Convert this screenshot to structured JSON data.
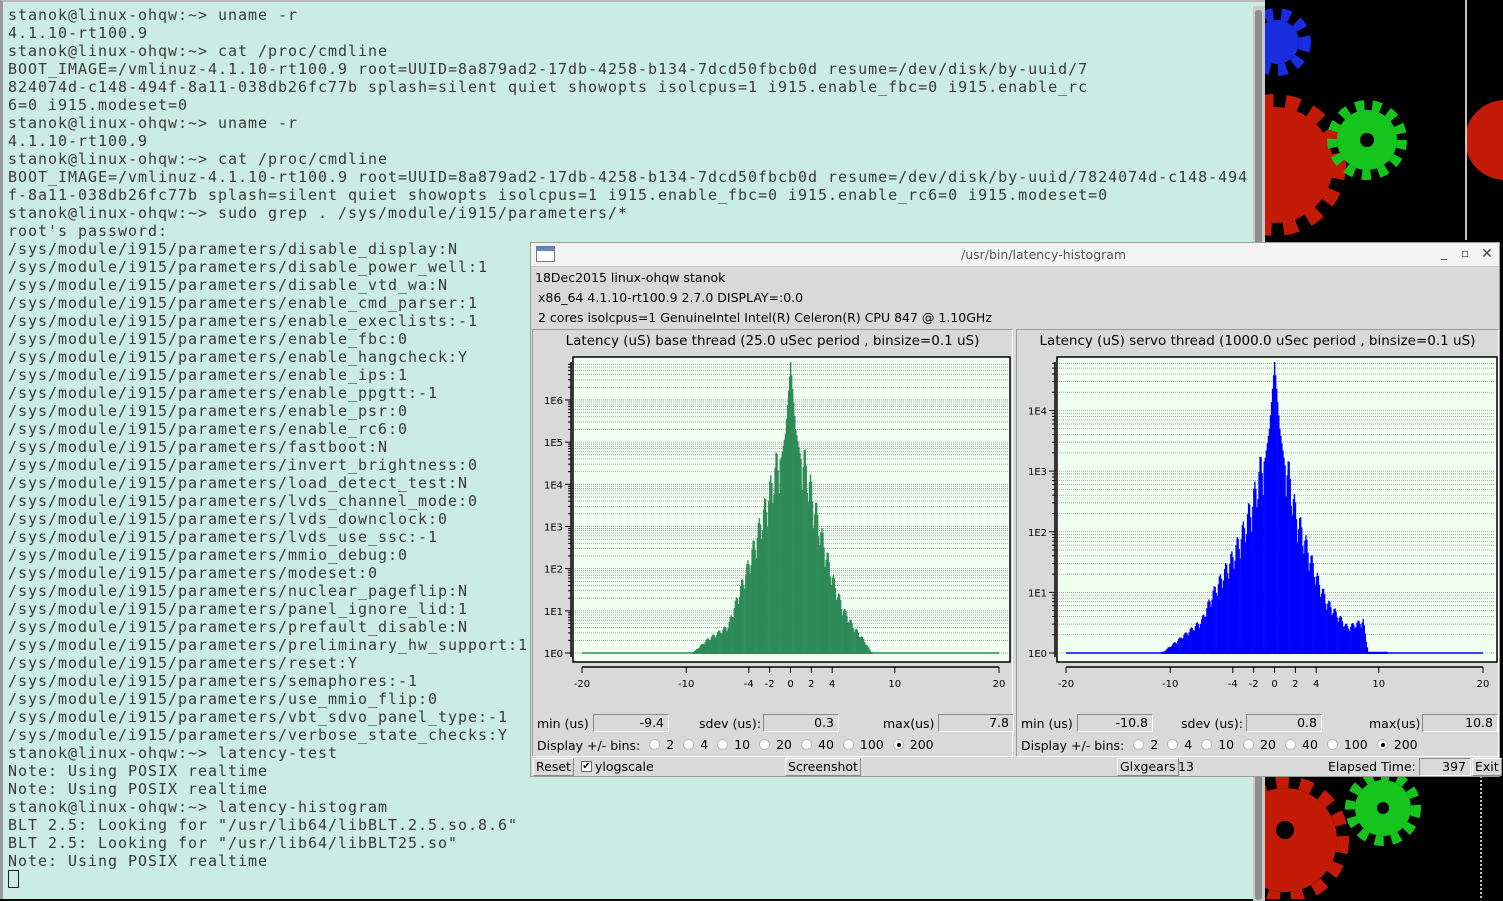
{
  "terminal": {
    "lines": [
      "stanok@linux-ohqw:~> uname -r",
      "4.1.10-rt100.9",
      "stanok@linux-ohqw:~> cat /proc/cmdline",
      "BOOT_IMAGE=/vmlinuz-4.1.10-rt100.9 root=UUID=8a879ad2-17db-4258-b134-7dcd50fbcb0d resume=/dev/disk/by-uuid/7",
      "824074d-c148-494f-8a11-038db26fc77b splash=silent quiet showopts isolcpus=1 i915.enable_fbc=0 i915.enable_rc",
      "6=0 i915.modeset=0",
      "stanok@linux-ohqw:~> uname -r",
      "4.1.10-rt100.9",
      "stanok@linux-ohqw:~> cat /proc/cmdline",
      "BOOT_IMAGE=/vmlinuz-4.1.10-rt100.9 root=UUID=8a879ad2-17db-4258-b134-7dcd50fbcb0d resume=/dev/disk/by-uuid/7824074d-c148-494",
      "f-8a11-038db26fc77b splash=silent quiet showopts isolcpus=1 i915.enable_fbc=0 i915.enable_rc6=0 i915.modeset=0",
      "stanok@linux-ohqw:~> sudo grep . /sys/module/i915/parameters/*",
      "root's password:",
      "/sys/module/i915/parameters/disable_display:N",
      "/sys/module/i915/parameters/disable_power_well:1",
      "/sys/module/i915/parameters/disable_vtd_wa:N",
      "/sys/module/i915/parameters/enable_cmd_parser:1",
      "/sys/module/i915/parameters/enable_execlists:-1",
      "/sys/module/i915/parameters/enable_fbc:0",
      "/sys/module/i915/parameters/enable_hangcheck:Y",
      "/sys/module/i915/parameters/enable_ips:1",
      "/sys/module/i915/parameters/enable_ppgtt:-1",
      "/sys/module/i915/parameters/enable_psr:0",
      "/sys/module/i915/parameters/enable_rc6:0",
      "/sys/module/i915/parameters/fastboot:N",
      "/sys/module/i915/parameters/invert_brightness:0",
      "/sys/module/i915/parameters/load_detect_test:N",
      "/sys/module/i915/parameters/lvds_channel_mode:0",
      "/sys/module/i915/parameters/lvds_downclock:0",
      "/sys/module/i915/parameters/lvds_use_ssc:-1",
      "/sys/module/i915/parameters/mmio_debug:0",
      "/sys/module/i915/parameters/modeset:0",
      "/sys/module/i915/parameters/nuclear_pageflip:N",
      "/sys/module/i915/parameters/panel_ignore_lid:1",
      "/sys/module/i915/parameters/prefault_disable:N",
      "/sys/module/i915/parameters/preliminary_hw_support:1",
      "/sys/module/i915/parameters/reset:Y",
      "/sys/module/i915/parameters/semaphores:-1",
      "/sys/module/i915/parameters/use_mmio_flip:0",
      "/sys/module/i915/parameters/vbt_sdvo_panel_type:-1",
      "/sys/module/i915/parameters/verbose_state_checks:Y",
      "stanok@linux-ohqw:~> latency-test",
      "Note: Using POSIX realtime",
      "Note: Using POSIX realtime",
      "stanok@linux-ohqw:~> latency-histogram",
      "BLT 2.5: Looking for \"/usr/lib64/libBLT.2.5.so.8.6\"",
      "BLT 2.5: Looking for \"/usr/lib64/libBLT25.so\"",
      "Note: Using POSIX realtime"
    ]
  },
  "window": {
    "title": "/usr/bin/latency-histogram",
    "info1": "18Dec2015 linux-ohqw stanok",
    "info2": "x86_64  4.1.10-rt100.9  2.7.0  DISPLAY=:0.0",
    "info3": "2 cores  isolcpus=1   GenuineIntel  Intel(R) Celeron(R) CPU 847 @ 1.10GHz",
    "reset": "Reset",
    "ylogscale": "ylogscale",
    "screenshot": "Screenshot",
    "glxgears": "Glxgears",
    "glxgears_count": "13",
    "elapsed_label": "Elapsed Time:",
    "elapsed": "397",
    "exit": "Exit",
    "min_label": "min (us)",
    "sdev_label": "sdev (us):",
    "max_label": "max(us)",
    "bins_label": "Display +/- bins:",
    "bins_options": [
      "2",
      "4",
      "10",
      "20",
      "40",
      "100",
      "200"
    ],
    "bins_selected": "200"
  },
  "colors": {
    "base": "#2e8b57",
    "servo": "#0000ff",
    "plot_bg": "#f0fff0",
    "terminal_bg": "#cbece2"
  },
  "chart_data": [
    {
      "type": "bar",
      "title": "Latency (uS) base thread (25.0 uSec period , binsize=0.1 uS)",
      "xlim": [
        -20,
        20
      ],
      "xticks": [
        "-20",
        "-10",
        "-4",
        "-2",
        "0",
        "2",
        "4",
        "10",
        "20"
      ],
      "yscale": "log",
      "ylim_log10": [
        0,
        6.9
      ],
      "yticks": [
        "1E0",
        "1E1",
        "1E2",
        "1E3",
        "1E4",
        "1E5",
        "1E6"
      ],
      "binsize": 0.1,
      "min": "-9.4",
      "sdev": "0.3",
      "max": "7.8",
      "envelope_x": [
        -9.4,
        -8,
        -6,
        -5,
        -4,
        -3,
        -2,
        -1,
        -0.5,
        0,
        0.5,
        1,
        2,
        3,
        4,
        5,
        6,
        7,
        7.8
      ],
      "envelope_log10_count": [
        0,
        0.3,
        0.6,
        1.3,
        2.0,
        2.8,
        3.6,
        4.5,
        5.2,
        6.9,
        5.3,
        4.6,
        3.6,
        2.6,
        1.7,
        1.0,
        0.6,
        0.3,
        0
      ]
    },
    {
      "type": "bar",
      "title": "Latency (uS) servo thread (1000.0 uSec period , binsize=0.1 uS)",
      "xlim": [
        -20,
        20
      ],
      "xticks": [
        "-20",
        "-10",
        "-4",
        "-2",
        "0",
        "2",
        "4",
        "10",
        "20"
      ],
      "yscale": "log",
      "ylim_log10": [
        0,
        4.8
      ],
      "yticks": [
        "1E0",
        "1E1",
        "1E2",
        "1E3",
        "1E4"
      ],
      "binsize": 0.1,
      "min": "-10.8",
      "sdev": "0.8",
      "max": "10.8",
      "envelope_x": [
        -10.8,
        -7,
        -6,
        -4,
        -3,
        -2,
        -1,
        -0.5,
        0,
        0.5,
        1,
        2,
        3,
        4,
        5,
        7,
        8.5,
        9,
        10.8
      ],
      "envelope_log10_count": [
        0,
        0.5,
        0.9,
        1.5,
        1.9,
        2.4,
        3.1,
        3.7,
        4.8,
        3.7,
        3.1,
        2.2,
        1.7,
        1.2,
        0.8,
        0.4,
        0.5,
        0,
        0
      ]
    }
  ]
}
